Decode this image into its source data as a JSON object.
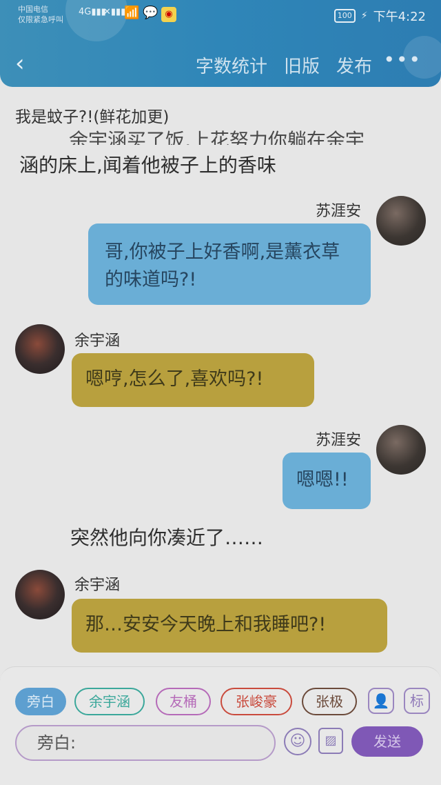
{
  "statusbar": {
    "carrier_line1": "中国电信",
    "carrier_line2": "仅限紧急呼叫",
    "signal": "4G",
    "battery": "100",
    "time": "下午4:22"
  },
  "header": {
    "back_icon": "‹",
    "actions": [
      "字数统计",
      "旧版",
      "发布"
    ],
    "more_icon": "•••"
  },
  "story": {
    "title": "我是蚊子?!(鲜花加更)",
    "partial_line": "余宇涵买了饭,上花努力你躺在余宇",
    "line1": "涵的床上,闻着他被子上的香味",
    "narration": "突然他向你凑近了……"
  },
  "messages": [
    {
      "speaker": "苏涯安",
      "text": "哥,你被子上好香啊,是薰衣草的味道吗?!",
      "side": "right"
    },
    {
      "speaker": "余宇涵",
      "text": "嗯哼,怎么了,喜欢吗?!",
      "side": "left"
    },
    {
      "speaker": "苏涯安",
      "text": "嗯嗯!!",
      "side": "right"
    },
    {
      "speaker": "余宇涵",
      "text": "那…安安今天晚上和我睡吧?!",
      "side": "left"
    }
  ],
  "chips": [
    "旁白",
    "余宇涵",
    "友桶",
    "张峻豪",
    "张极"
  ],
  "chip_colors": {
    "active_bg": "#5d9fd0",
    "chip2": "#3aa79a",
    "chip3": "#b56ab8",
    "chip4": "#c94a3c",
    "chip5": "#6b4a3a"
  },
  "toolbar_icons": [
    "person-card-icon",
    "tag-icon"
  ],
  "input": {
    "placeholder": "旁白:"
  },
  "emoji_icon": "☺",
  "image_icon": "▨",
  "send_label": "发送"
}
